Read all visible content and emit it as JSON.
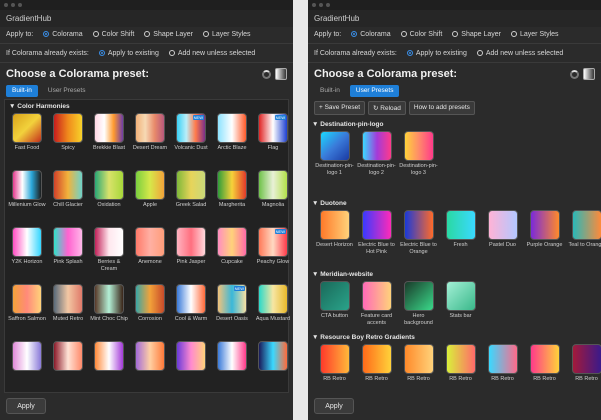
{
  "left": {
    "app_name": "GradientHub",
    "apply_to_label": "Apply to:",
    "apply_to_options": [
      "Colorama",
      "Color Shift",
      "Shape Layer",
      "Layer Styles"
    ],
    "exists_label": "If Colorama already exists:",
    "exists_options": [
      "Apply to existing",
      "Add new unless selected"
    ],
    "heading": "Choose a Colorama preset:",
    "tabs": [
      "Built-in",
      "User Presets"
    ],
    "group": "Color Harmonies",
    "apply_button": "Apply",
    "presets": [
      {
        "label": "Fast Food",
        "g": "linear-gradient(135deg,#d9a21b,#f2d23c,#c5301b)"
      },
      {
        "label": "Spicy",
        "g": "linear-gradient(90deg,#c81d1d,#f08a1c,#f7d22a)"
      },
      {
        "label": "Brekkie Blast",
        "g": "linear-gradient(90deg,#ffd7e4,#ffffff,#ff9a2e,#6e3ca8)"
      },
      {
        "label": "Desert Dream",
        "g": "linear-gradient(90deg,#f2b27a,#f6d9b4,#e88a6a,#b8587c)"
      },
      {
        "label": "Volcanic Dust",
        "g": "linear-gradient(90deg,#3bd1f5,#b9eef9,#ff7a4a,#7a2f8a)",
        "new": "NEW"
      },
      {
        "label": "Arctic Blaze",
        "g": "linear-gradient(90deg,#8ee3ff,#ffffff,#ff5a2a)"
      },
      {
        "label": "Flag",
        "g": "linear-gradient(90deg,#e02424,#ffffff,#1d3fd1)",
        "new": "NEW"
      },
      {
        "label": "Millenium Glow",
        "g": "linear-gradient(90deg,#e23c8f,#ffffff,#2aa7d9,#1e1e1e)"
      },
      {
        "label": "Chill Glacier",
        "g": "linear-gradient(90deg,#d1422a,#f2b33c,#6fd2c9)"
      },
      {
        "label": "Oxidation",
        "g": "linear-gradient(90deg,#2aa876,#d9e26b,#a7d83a)"
      },
      {
        "label": "Apple",
        "g": "linear-gradient(90deg,#7bcf3f,#d6e84a,#f2a33a)"
      },
      {
        "label": "Greek Salad",
        "g": "linear-gradient(90deg,#7fb83a,#e7d45a,#c9d97a)"
      },
      {
        "label": "Margherita",
        "g": "linear-gradient(90deg,#2f9d3a,#f7d23a,#e23a2a)"
      },
      {
        "label": "Magnolia",
        "g": "linear-gradient(90deg,#6fc24a,#e9f0d7,#b2e04a)"
      },
      {
        "label": "Y2K Horizon",
        "g": "linear-gradient(90deg,#ff4fc3,#ffffff,#33d6ff)"
      },
      {
        "label": "Pink Splash",
        "g": "linear-gradient(90deg,#2fe3c9,#ff62d0,#ffb8e9)"
      },
      {
        "label": "Berries & Cream",
        "g": "linear-gradient(90deg,#c2235a,#ffe7ee,#ffffff)"
      },
      {
        "label": "Anemone",
        "g": "linear-gradient(90deg,#ff7a6a,#ffb0a3,#ff9d7a)"
      },
      {
        "label": "Pink Jasper",
        "g": "linear-gradient(90deg,#ffb3c0,#ff6f7f,#ffd8dc)"
      },
      {
        "label": "Cupcake",
        "g": "linear-gradient(90deg,#ff8ec0,#ffd27a,#ff6aa8)"
      },
      {
        "label": "Peachy Glow",
        "g": "linear-gradient(90deg,#ff7a5a,#ffd9c2,#ff3a4a)",
        "new": "NEW"
      },
      {
        "label": "Saffron Salmon",
        "g": "linear-gradient(90deg,#f4a23a,#ff8a7a,#ffd27a)"
      },
      {
        "label": "Muted Retro",
        "g": "linear-gradient(90deg,#5a6b7a,#f2c7a3,#e07a6a)"
      },
      {
        "label": "Mint Choc Chip",
        "g": "linear-gradient(90deg,#5a3a2a,#b3f0d6,#3a2418)"
      },
      {
        "label": "Corrosion",
        "g": "linear-gradient(90deg,#3aa6a6,#f2a23a,#c84a2a)"
      },
      {
        "label": "Cool & Warm",
        "g": "linear-gradient(90deg,#3a7ad9,#ffffff,#ff6a3a)"
      },
      {
        "label": "Desert Oasis",
        "g": "linear-gradient(90deg,#f2c27a,#3ab8d9,#f7e0a3)",
        "new": "NEW"
      },
      {
        "label": "Aqua Mustard",
        "g": "linear-gradient(90deg,#2ad9c9,#f7e6a3,#e8b82a)"
      },
      {
        "label": "",
        "g": "linear-gradient(90deg,#e08ad9,#ffffff,#8a7ad9)"
      },
      {
        "label": "",
        "g": "linear-gradient(90deg,#8a1a2a,#ffe3d6,#ff8a6a)"
      },
      {
        "label": "",
        "g": "linear-gradient(90deg,#ff8a3a,#ffffff,#a33ad9)"
      },
      {
        "label": "",
        "g": "linear-gradient(90deg,#a36ad9,#ffd0a3,#ff7a3a)"
      },
      {
        "label": "",
        "g": "linear-gradient(90deg,#6a3ad9,#ff8ad0,#ffd27a)"
      },
      {
        "label": "",
        "g": "linear-gradient(90deg,#3a7ad9,#ffffff,#ff3a8a)"
      },
      {
        "label": "",
        "g": "linear-gradient(90deg,#1a1a5a,#3ad9ff,#ff6a3a)"
      }
    ]
  },
  "right": {
    "app_name": "GradientHub",
    "apply_to_label": "Apply to:",
    "apply_to_options": [
      "Colorama",
      "Color Shift",
      "Shape Layer",
      "Layer Styles"
    ],
    "exists_label": "If Colorama already exists:",
    "exists_options": [
      "Apply to existing",
      "Add new unless selected"
    ],
    "heading": "Choose a Colorama preset:",
    "tabs": [
      "Built-in",
      "User Presets"
    ],
    "toolbar": [
      "+ Save Preset",
      "↻ Reload",
      "How to add presets"
    ],
    "apply_button": "Apply",
    "groups": [
      {
        "title": "Destination-pin-logo",
        "items": [
          {
            "label": "Destination-pin-logo 1",
            "g": "linear-gradient(135deg,#1ad9ff,#3a7ad9,#1a3aa3)"
          },
          {
            "label": "Destination-pin-logo 2",
            "g": "linear-gradient(90deg,#3ad9ff,#a33ad9,#ff3a8a)"
          },
          {
            "label": "Destination-pin-logo 3",
            "g": "linear-gradient(90deg,#ffd23a,#ff8a6a,#ff3a8a)"
          }
        ]
      },
      {
        "title": "Duotone",
        "items": [
          {
            "label": "Desert Horizon",
            "g": "linear-gradient(90deg,#ff7a2a,#ffd27a)"
          },
          {
            "label": "Electric Blue to Hot Pink",
            "g": "linear-gradient(90deg,#3a3aff,#ff2ab8)"
          },
          {
            "label": "Electric Blue to Orange",
            "g": "linear-gradient(90deg,#1a3ad9,#ff6a2a)"
          },
          {
            "label": "Fresh",
            "g": "linear-gradient(90deg,#2ad9a3,#3ad9ff)"
          },
          {
            "label": "Pastel Duo",
            "g": "linear-gradient(90deg,#ffb3d6,#b3c7ff)"
          },
          {
            "label": "Purple Orange",
            "g": "linear-gradient(90deg,#7a2ad9,#ff8a2a)"
          },
          {
            "label": "Teal to Orange",
            "g": "linear-gradient(90deg,#2ab8b8,#ff8a3a)"
          }
        ]
      },
      {
        "title": "Meridian-website",
        "items": [
          {
            "label": "CTA button",
            "g": "linear-gradient(135deg,#1a6a5a,#2aa38a)"
          },
          {
            "label": "Feature card accents",
            "g": "linear-gradient(90deg,#ff6ab8,#ffd27a)"
          },
          {
            "label": "Hero background",
            "g": "linear-gradient(135deg,#1a3a2a,#3ad98a)"
          },
          {
            "label": "Stats bar",
            "g": "linear-gradient(135deg,#a3f0d6,#3ab88a)"
          }
        ]
      },
      {
        "title": "Resource Boy Retro Gradients",
        "items": [
          {
            "label": "RB Retro",
            "g": "linear-gradient(90deg,#ff3a2a,#ffb83a)"
          },
          {
            "label": "RB Retro",
            "g": "linear-gradient(90deg,#ff6a1a,#ffd23a)"
          },
          {
            "label": "RB Retro",
            "g": "linear-gradient(90deg,#ff8a2a,#ffd27a)"
          },
          {
            "label": "RB Retro",
            "g": "linear-gradient(90deg,#d9f03a,#ff6a6a)"
          },
          {
            "label": "RB Retro",
            "g": "linear-gradient(90deg,#3ad9ff,#ff6a8a)"
          },
          {
            "label": "RB Retro",
            "g": "linear-gradient(90deg,#ff3a8a,#ffd23a)"
          },
          {
            "label": "RB Retro",
            "g": "linear-gradient(90deg,#a31a3a,#3a1a8a)"
          }
        ]
      }
    ]
  }
}
